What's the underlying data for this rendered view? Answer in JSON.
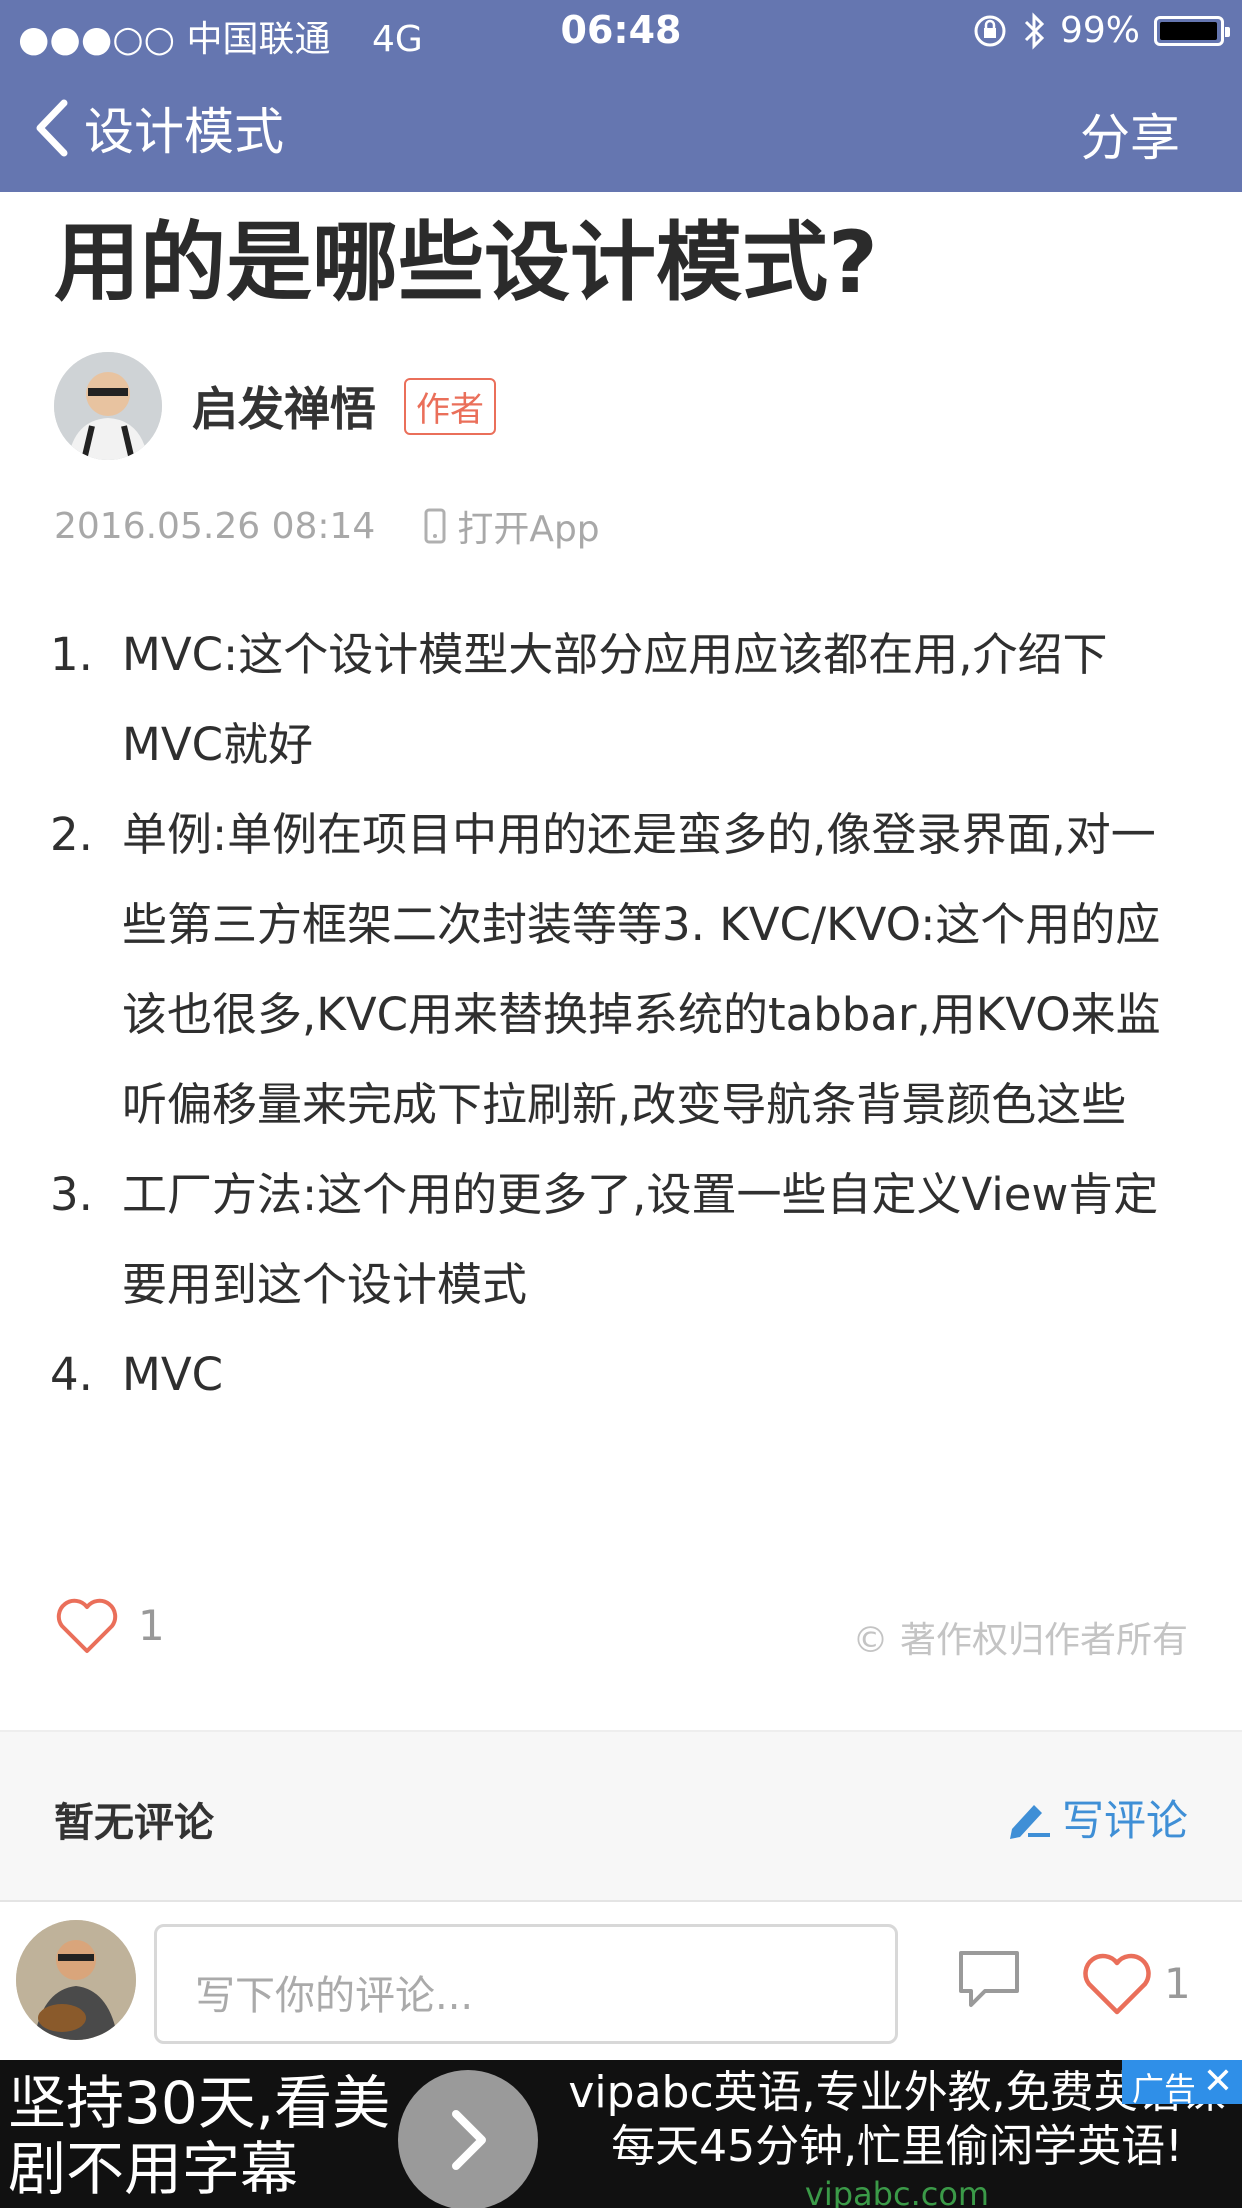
{
  "status_bar": {
    "carrier": "●●●○○ 中国联通",
    "network": "4G",
    "time": "06:48",
    "battery": "99%",
    "battery_level": 0.99
  },
  "nav": {
    "back_label": "设计模式",
    "share_label": "分享"
  },
  "article": {
    "title": "用的是哪些设计模式?",
    "author": "启发禅悟",
    "author_badge": "作者",
    "date": "2016.05.26 08:14",
    "open_app": "打开App",
    "items": [
      {
        "num": "1.",
        "text": "MVC:这个设计模型大部分应用应该都在用,介绍下MVC就好"
      },
      {
        "num": "2.",
        "text": "单例:单例在项目中用的还是蛮多的,像登录界面,对一些第三方框架二次封装等等3. KVC/KVO:这个用的应该也很多,KVC用来替换掉系统的tabbar,用KVO来监听偏移量来完成下拉刷新,改变导航条背景颜色这些"
      },
      {
        "num": "3.",
        "text": "工厂方法:这个用的更多了,设置一些自定义View肯定要用到这个设计模式"
      },
      {
        "num": "4.",
        "text": "MVC"
      }
    ],
    "like_count": "1",
    "copyright": "© 著作权归作者所有"
  },
  "comments": {
    "no_comments": "暂无评论",
    "write_comment": "写评论",
    "input_placeholder": "写下你的评论...",
    "like_count": "1"
  },
  "ad": {
    "left_text": "坚持30天,看美剧不用字幕",
    "right_line1": "vipabc英语,专业外教,免费英语课",
    "right_line2": "每天45分钟,忙里偷闲学英语!",
    "url": "vipabc.com",
    "tag": "广告",
    "close": "✕"
  },
  "colors": {
    "nav_bg": "#6576b0",
    "accent": "#ea6f5a",
    "link": "#3f8fd6"
  }
}
